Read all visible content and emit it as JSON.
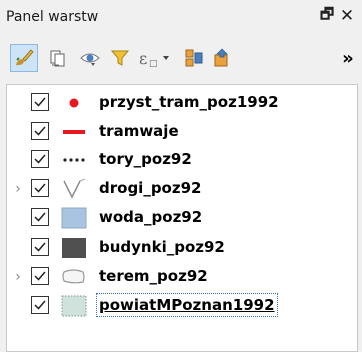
{
  "panel": {
    "title": "Panel warstw",
    "float_icon": "float-panel-icon",
    "close_icon": "close-icon",
    "float_glyph": "🗗",
    "close_glyph": "✕"
  },
  "toolbar": {
    "items": [
      {
        "icon": "style-manager-icon",
        "active": true
      },
      {
        "icon": "add-group-icon"
      },
      {
        "icon": "manage-visibility-icon"
      },
      {
        "icon": "filter-legend-icon"
      },
      {
        "icon": "filter-expression-icon"
      },
      {
        "icon": "expand-all-icon"
      },
      {
        "icon": "collapse-all-icon"
      },
      {
        "icon": "more-chevron-icon"
      }
    ],
    "more_label": "»"
  },
  "layers": [
    {
      "name": "przyst_tram_poz1992",
      "symbol": "red-dot",
      "checked": true,
      "expandable": false
    },
    {
      "name": "tramwaje",
      "symbol": "red-line",
      "checked": true,
      "expandable": false
    },
    {
      "name": "tory_poz92",
      "symbol": "dotted-line",
      "checked": true,
      "expandable": false
    },
    {
      "name": "drogi_poz92",
      "symbol": "rule-based-lines",
      "checked": true,
      "expandable": true
    },
    {
      "name": "woda_poz92",
      "symbol": "light-blue-fill",
      "checked": true,
      "expandable": false
    },
    {
      "name": "budynki_poz92",
      "symbol": "dark-gray-fill",
      "checked": true,
      "expandable": false
    },
    {
      "name": "terem_poz92",
      "symbol": "rule-based-polygons",
      "checked": true,
      "expandable": true
    },
    {
      "name": "powiatMPoznan1992",
      "symbol": "pale-teal-fill",
      "checked": true,
      "expandable": false,
      "selected": true
    }
  ],
  "expander_glyph": "›",
  "colors": {
    "stop_red": "#e8181e",
    "tram_red": "#e8181e",
    "water_fill": "#a8c4e0",
    "water_border": "#8fa9c4",
    "building_fill": "#505050",
    "county_fill": "#cfe3dc",
    "county_border": "#7a9a90",
    "selection_outline": "#3a76b5"
  }
}
